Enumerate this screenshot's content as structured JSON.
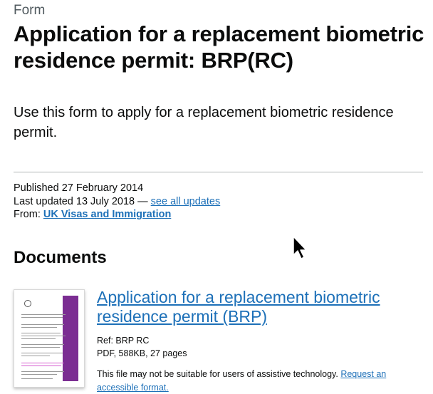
{
  "header": {
    "document_type": "Form",
    "title": "Application for a replacement biometric residence permit: BRP(RC)"
  },
  "lead": "Use this form to apply for a replacement biometric residence permit.",
  "metadata": {
    "published_label": "Published 27 February 2014",
    "last_updated_label": "Last updated 13 July 2018 —",
    "see_all_updates": "see all updates",
    "from_label": "From:",
    "from_org": "UK Visas and Immigration"
  },
  "documents": {
    "heading": "Documents",
    "items": [
      {
        "title": "Application for a replacement biometric residence permit (BRP)",
        "ref": "Ref: BRP RC",
        "file_info": "PDF, 588KB, 27 pages",
        "accessibility_note": "This file may not be suitable for users of assistive technology.",
        "request_link": "Request an accessible format."
      }
    ]
  },
  "colors": {
    "link": "#1d70b8",
    "text": "#0b0c0c",
    "secondary_text": "#505a5f",
    "thumbnail_band": "#7b2d92"
  },
  "icons": [
    "mouse-pointer-icon"
  ]
}
